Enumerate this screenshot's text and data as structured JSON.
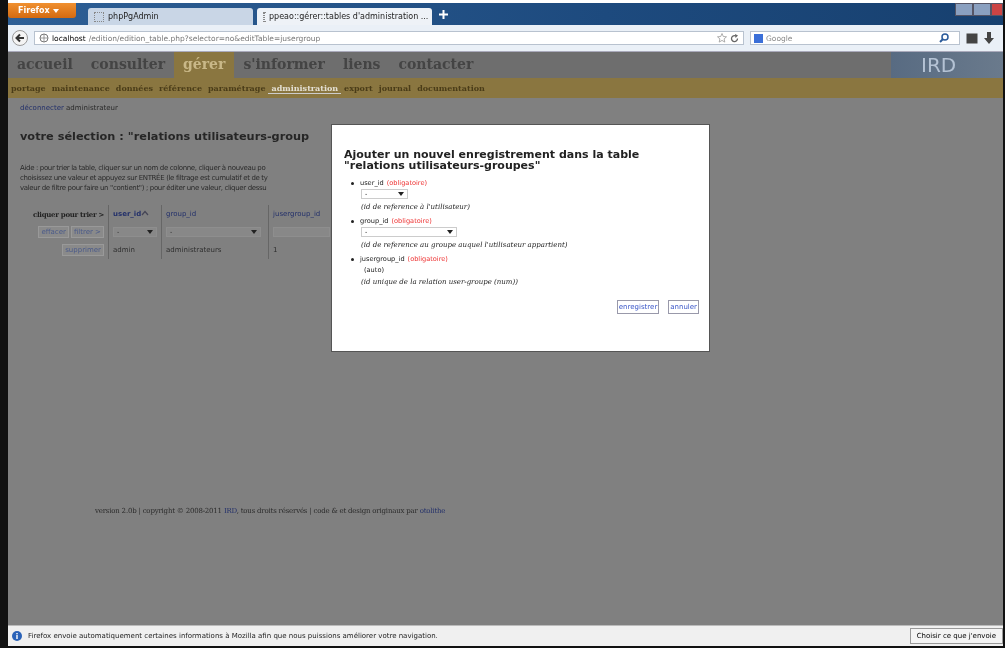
{
  "browser": {
    "menu_button": "Firefox",
    "tabs": [
      {
        "label": "phpPgAdmin",
        "selected": false
      },
      {
        "label": "ppeao::gérer::tables d'administration ...",
        "selected": true
      }
    ],
    "url": {
      "host": "localhost",
      "path": "/edition/edition_table.php?selector=no&editTable=jusergroup"
    },
    "search": {
      "placeholder": "Google"
    }
  },
  "site": {
    "main_menu": [
      {
        "label": "accueil",
        "selected": false
      },
      {
        "label": "consulter",
        "selected": false
      },
      {
        "label": "gérer",
        "selected": true
      },
      {
        "label": "s'informer",
        "selected": false
      },
      {
        "label": "liens",
        "selected": false
      },
      {
        "label": "contacter",
        "selected": false
      }
    ],
    "logo": "IRD",
    "sub_menu": [
      {
        "label": "portage",
        "selected": false
      },
      {
        "label": "maintenance",
        "selected": false
      },
      {
        "label": "données",
        "selected": false
      },
      {
        "label": "référence",
        "selected": false
      },
      {
        "label": "paramétrage",
        "selected": false
      },
      {
        "label": "administration",
        "selected": true
      },
      {
        "label": "export",
        "selected": false
      },
      {
        "label": "journal",
        "selected": false
      },
      {
        "label": "documentation",
        "selected": false
      }
    ],
    "logout_link": "déconnecter",
    "user": "administrateur",
    "page_title": "votre sélection : \"relations utilisateurs-group",
    "help_lines": [
      "Aide : pour trier la table, cliquer sur un nom de colonne, cliquer à nouveau po",
      "choisissez une valeur et appuyez sur ENTRÉE (le filtrage est cumulatif et de ty",
      "valeur de filtre pour faire un \"contient\") ; pour éditer une valeur, cliquer dessu"
    ],
    "table": {
      "sort_label": "cliquer pour trier >",
      "clear_button": "effacer",
      "filter_button": "filtrer >",
      "columns": [
        {
          "label": "user_id",
          "sorted": true,
          "kind": "select",
          "filter": "-"
        },
        {
          "label": "group_id",
          "sorted": false,
          "kind": "select",
          "filter": "-"
        },
        {
          "label": "jusergroup_id",
          "sorted": false,
          "kind": "text"
        }
      ],
      "rows": [
        {
          "action": "supprimer",
          "cells": [
            "admin",
            "administrateurs",
            "1"
          ]
        }
      ]
    },
    "footer": {
      "text": "version 2.0b | copyright © 2008-2011",
      "link1": "IRD",
      "text2": ", tous droits réservés | code & et design originaux par",
      "link2": "otolithe"
    }
  },
  "dialog": {
    "title_lines": [
      "Ajouter un nouvel enregistrement dans la table",
      "\"relations utilisateurs-groupes\""
    ],
    "fields": [
      {
        "name": "user_id",
        "required": "(obligatoire)",
        "kind": "select",
        "value": "-",
        "note": "(id de reference à l'utilisateur)"
      },
      {
        "name": "group_id",
        "required": "(obligatoire)",
        "kind": "select",
        "value": "-",
        "note": "(id de reference au groupe auquel l'utilisateur appartient)"
      },
      {
        "name": "jusergroup_id",
        "required": "(obligatoire)",
        "kind": "auto",
        "value": "(auto)",
        "note": "(id unique de la relation user-groupe (num))"
      }
    ],
    "buttons": [
      "enregistrer",
      "annuler"
    ]
  },
  "notification": {
    "text": "Firefox envoie automatiquement certaines informations à Mozilla afin que nous puissions améliorer votre navigation.",
    "button": "Choisir ce que j'envoie"
  }
}
